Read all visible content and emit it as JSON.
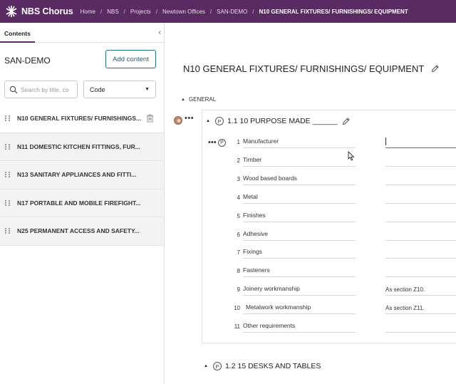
{
  "app": {
    "brand": "NBS Chorus"
  },
  "breadcrumbs": [
    "Home",
    "NBS",
    "Projects",
    "Newtown Offices",
    "SAN-DEMO",
    "N10 GENERAL FIXTURES/ FURNISHINGS/ EQUIPMENT"
  ],
  "sidebar": {
    "tab_label": "Contents",
    "project_title": "SAN-DEMO",
    "add_button": "Add content",
    "search_placeholder": "Search by title, co",
    "sort_value": "Code",
    "items": [
      {
        "label": "N10 GENERAL FIXTURES/ FURNISHINGS..."
      },
      {
        "label": "N11 DOMESTIC KITCHEN FITTINGS, FUR..."
      },
      {
        "label": "N13 SANITARY APPLIANCES AND FITTI..."
      },
      {
        "label": "N17 PORTABLE AND MOBILE FIREFIGHT..."
      },
      {
        "label": "N25 PERMANENT ACCESS AND SAFETY..."
      }
    ]
  },
  "main": {
    "title": "N10 GENERAL FIXTURES/ FURNISHINGS/ EQUIPMENT",
    "group_label": "GENERAL",
    "clause1": {
      "number": "1.1",
      "title": "10 PURPOSE MADE ______"
    },
    "clause2": {
      "number": "1.2",
      "title": "15 DESKS AND TABLES"
    },
    "badge": "P",
    "rows": [
      {
        "num": "1",
        "label": "Manufacturer",
        "value": ""
      },
      {
        "num": "2",
        "label": "Timber",
        "value": ""
      },
      {
        "num": "3",
        "label": "Wood based boards",
        "value": ""
      },
      {
        "num": "4",
        "label": "Metal",
        "value": ""
      },
      {
        "num": "5",
        "label": "Finishes",
        "value": ""
      },
      {
        "num": "6",
        "label": "Adhesive",
        "value": ""
      },
      {
        "num": "7",
        "label": "Fixings",
        "value": ""
      },
      {
        "num": "8",
        "label": "Fasteners",
        "value": ""
      },
      {
        "num": "9",
        "label": "Joinery workmanship",
        "value": "As section Z10."
      },
      {
        "num": "10",
        "label": "Metalwork workmanship",
        "value": "As section Z11."
      },
      {
        "num": "11",
        "label": "Other requirements",
        "value": ""
      }
    ]
  }
}
